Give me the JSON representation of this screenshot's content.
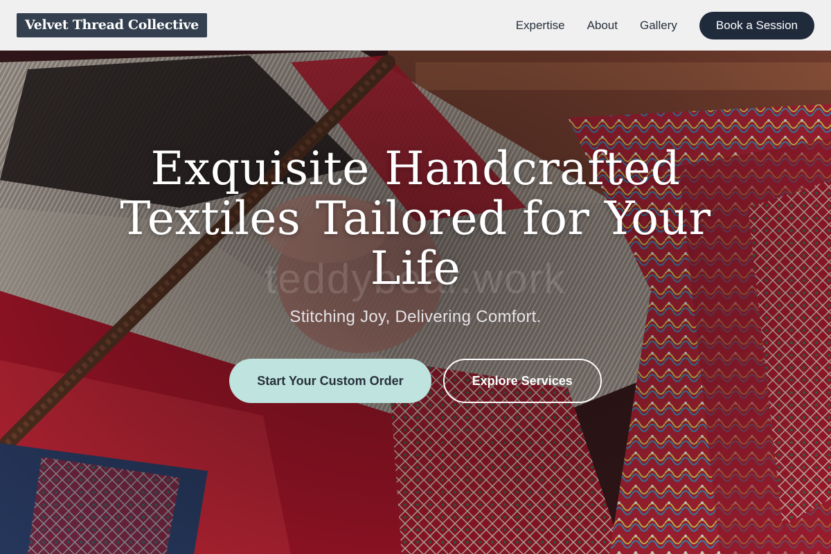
{
  "brand": {
    "name": "Velvet Thread Collective",
    "colors": {
      "dark": "#1f2a3b",
      "logo_bg": "#34404f",
      "accent": "#bfe3de",
      "header_bg": "#f1f0f0"
    }
  },
  "nav": {
    "links": [
      "Expertise",
      "About",
      "Gallery"
    ],
    "cta_label": "Book a Session"
  },
  "hero": {
    "title": "Exquisite Handcrafted Textiles Tailored for Your Life",
    "subtitle": "Stitching Joy, Delivering Comfort.",
    "watermark": "teddybear.work",
    "primary_button": "Start Your Custom Order",
    "secondary_button": "Explore Services",
    "background_image": "hand-weaving-loom-photo"
  }
}
